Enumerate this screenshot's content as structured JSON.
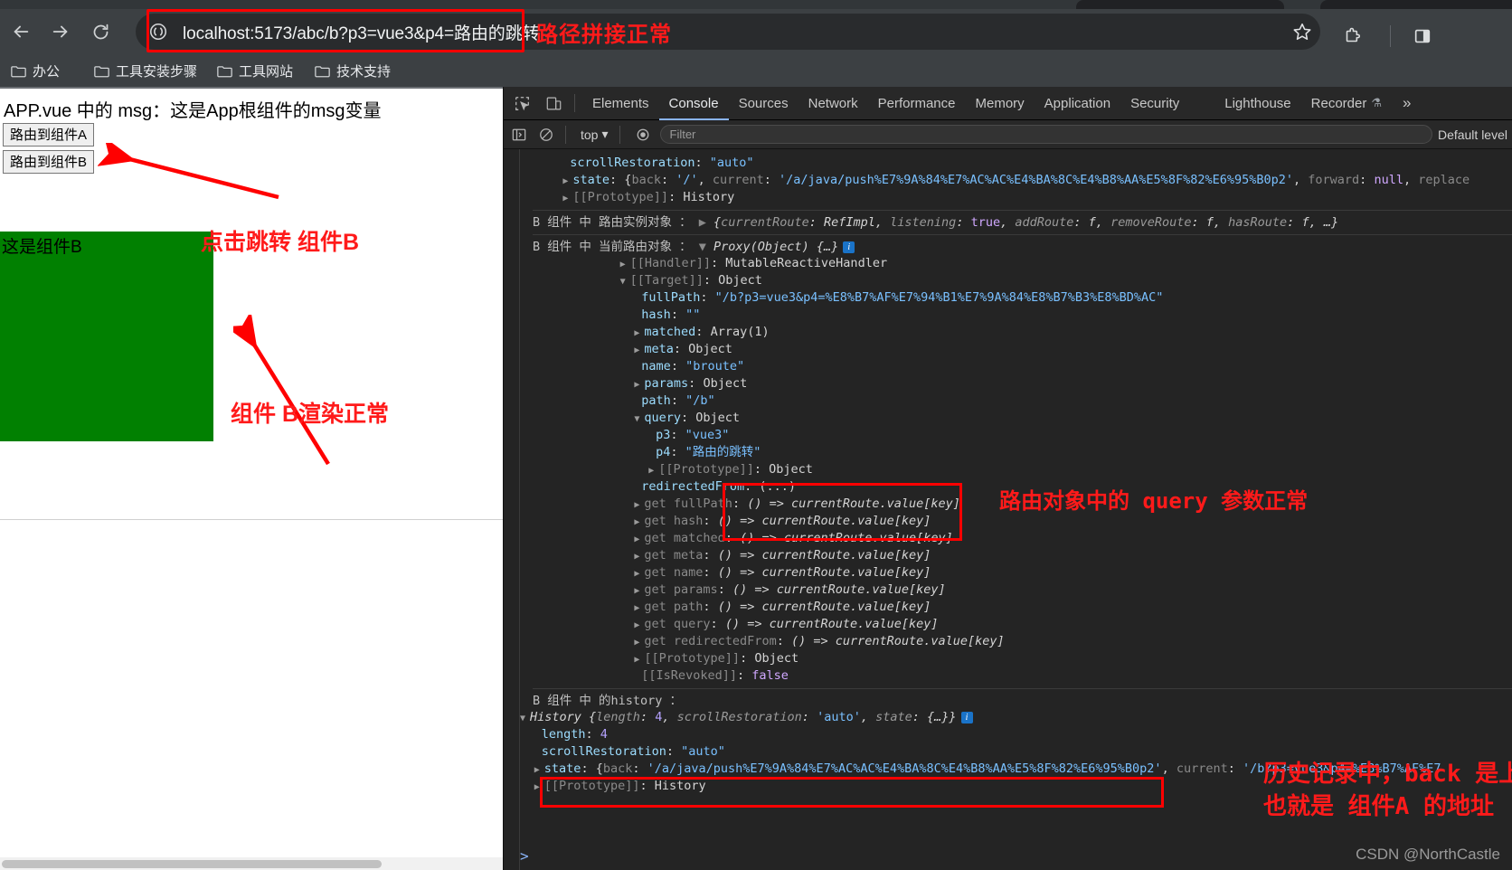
{
  "browser": {
    "url": "localhost:5173/abc/b?p3=vue3&p4=路由的跳转",
    "back_icon": "back-arrow-icon",
    "forward_icon": "forward-arrow-icon",
    "reload_icon": "reload-icon",
    "site_info_icon": "site-info-icon",
    "star_icon": "bookmark-star-icon",
    "extensions_icon": "extensions-puzzle-icon",
    "sidepanel_icon": "side-panel-icon",
    "bookmarks": [
      {
        "label": "办公"
      },
      {
        "label": "工具安装步骤"
      },
      {
        "label": "工具网站"
      },
      {
        "label": "技术支持"
      }
    ]
  },
  "annotations": {
    "url_note": "路径拼接正常",
    "jump_note": "点击跳转 组件B",
    "render_note": "组件 B渲染正常",
    "query_note": "路由对象中的 query 参数正常",
    "history_note_line1": "历史记录中，back 是上一个路由地址",
    "history_note_line2": "也就是 组件A 的地址",
    "color": "#ff1a1a"
  },
  "page": {
    "msg": "APP.vue 中的 msg：这是App根组件的msg变量",
    "button_a": "路由到组件A",
    "button_b": "路由到组件B",
    "component_b_label": "这是组件B",
    "component_b_color": "#018001"
  },
  "devtools": {
    "inspect_icon": "inspect-element-icon",
    "device_icon": "device-toolbar-icon",
    "tabs": [
      {
        "label": "Elements",
        "active": false
      },
      {
        "label": "Console",
        "active": true
      },
      {
        "label": "Sources",
        "active": false
      },
      {
        "label": "Network",
        "active": false
      },
      {
        "label": "Performance",
        "active": false
      },
      {
        "label": "Memory",
        "active": false
      },
      {
        "label": "Application",
        "active": false
      },
      {
        "label": "Security",
        "active": false
      },
      {
        "label": "Lighthouse",
        "active": false
      },
      {
        "label": "Recorder",
        "active": false,
        "flask": "⚗"
      }
    ],
    "more_tabs": "»",
    "filterbar": {
      "sidebar_icon": "console-sidebar-icon",
      "clear_icon": "clear-console-icon",
      "context": "top",
      "context_caret": "▾",
      "eye_icon": "live-expression-icon",
      "filter_placeholder": "Filter",
      "level": "Default level"
    },
    "prompt_caret": ">",
    "watermark": "CSDN @NorthCastle",
    "console_lines": [
      {
        "indent": 7,
        "parts": [
          {
            "t": "scrollRestoration",
            "c": "k-prop"
          },
          {
            "t": ": ",
            "c": "k-plain"
          },
          {
            "t": "\"auto\"",
            "c": "k-str"
          }
        ]
      },
      {
        "indent": 6,
        "tri": "▶",
        "parts": [
          {
            "t": "state",
            "c": "k-prop"
          },
          {
            "t": ": ",
            "c": "k-plain"
          },
          {
            "t": "{",
            "c": "k-plain"
          },
          {
            "t": "back",
            "c": "k-dim"
          },
          {
            "t": ": ",
            "c": "k-plain"
          },
          {
            "t": "'/'",
            "c": "k-str"
          },
          {
            "t": ", ",
            "c": "k-plain"
          },
          {
            "t": "current",
            "c": "k-dim"
          },
          {
            "t": ": ",
            "c": "k-plain"
          },
          {
            "t": "'/a/java/push%E7%9A%84%E7%AC%AC%E4%BA%8C%E4%B8%AA%E5%8F%82%E6%95%B0p2'",
            "c": "k-str"
          },
          {
            "t": ", ",
            "c": "k-plain"
          },
          {
            "t": "forward",
            "c": "k-dim"
          },
          {
            "t": ": ",
            "c": "k-plain"
          },
          {
            "t": "null",
            "c": "k-kw"
          },
          {
            "t": ", ",
            "c": "k-plain"
          },
          {
            "t": "replace",
            "c": "k-dim"
          }
        ]
      },
      {
        "indent": 6,
        "tri": "▶",
        "parts": [
          {
            "t": "[[Prototype]]",
            "c": "k-dim"
          },
          {
            "t": ": ",
            "c": "k-plain"
          },
          {
            "t": "History",
            "c": "k-plain"
          }
        ]
      },
      {
        "group": true,
        "indent": 0,
        "parts": [
          {
            "t": "B 组件 中 路由实例对象 ：",
            "c": "srcB"
          },
          {
            "t": "   ▶ ",
            "c": "k-dim"
          },
          {
            "t": "{",
            "c": "k-ital"
          },
          {
            "t": "currentRoute",
            "c": "k-ital-dim"
          },
          {
            "t": ": ",
            "c": "k-ital"
          },
          {
            "t": "RefImpl",
            "c": "k-ital"
          },
          {
            "t": ", ",
            "c": "k-ital"
          },
          {
            "t": "listening",
            "c": "k-ital-dim"
          },
          {
            "t": ": ",
            "c": "k-ital"
          },
          {
            "t": "true",
            "c": "k-kw"
          },
          {
            "t": ", ",
            "c": "k-ital"
          },
          {
            "t": "addRoute",
            "c": "k-ital-dim"
          },
          {
            "t": ": ",
            "c": "k-ital"
          },
          {
            "t": "f",
            "c": "k-ital"
          },
          {
            "t": ", ",
            "c": "k-ital"
          },
          {
            "t": "removeRoute",
            "c": "k-ital-dim"
          },
          {
            "t": ": ",
            "c": "k-ital"
          },
          {
            "t": "f",
            "c": "k-ital"
          },
          {
            "t": ", ",
            "c": "k-ital"
          },
          {
            "t": "hasRoute",
            "c": "k-ital-dim"
          },
          {
            "t": ": ",
            "c": "k-ital"
          },
          {
            "t": "f",
            "c": "k-ital"
          },
          {
            "t": ", …}",
            "c": "k-ital"
          }
        ]
      },
      {
        "group": true,
        "indent": 0,
        "parts": [
          {
            "t": "B 组件 中 当前路由对象 ：",
            "c": "srcB"
          },
          {
            "t": "   ▼ ",
            "c": "k-dim"
          },
          {
            "t": "Proxy(Object) {…}",
            "c": "k-ital"
          },
          {
            "t": " ⓘ",
            "c": "badge"
          }
        ]
      },
      {
        "indent": 14,
        "tri": "▶",
        "parts": [
          {
            "t": "[[Handler]]",
            "c": "k-dim"
          },
          {
            "t": ": ",
            "c": "k-plain"
          },
          {
            "t": "MutableReactiveHandler",
            "c": "k-plain"
          }
        ]
      },
      {
        "indent": 14,
        "tri": "▼",
        "parts": [
          {
            "t": "[[Target]]",
            "c": "k-dim"
          },
          {
            "t": ": ",
            "c": "k-plain"
          },
          {
            "t": "Object",
            "c": "k-plain"
          }
        ]
      },
      {
        "indent": 17,
        "parts": [
          {
            "t": "fullPath",
            "c": "k-prop"
          },
          {
            "t": ": ",
            "c": "k-plain"
          },
          {
            "t": "\"/b?p3=vue3&p4=%E8%B7%AF%E7%94%B1%E7%9A%84%E8%B7%B3%E8%BD%AC\"",
            "c": "k-str"
          }
        ]
      },
      {
        "indent": 17,
        "parts": [
          {
            "t": "hash",
            "c": "k-prop"
          },
          {
            "t": ": ",
            "c": "k-plain"
          },
          {
            "t": "\"\"",
            "c": "k-str"
          }
        ]
      },
      {
        "indent": 16,
        "tri": "▶",
        "parts": [
          {
            "t": "matched",
            "c": "k-prop"
          },
          {
            "t": ": ",
            "c": "k-plain"
          },
          {
            "t": "Array(1)",
            "c": "k-plain"
          }
        ]
      },
      {
        "indent": 16,
        "tri": "▶",
        "parts": [
          {
            "t": "meta",
            "c": "k-prop"
          },
          {
            "t": ": ",
            "c": "k-plain"
          },
          {
            "t": "Object",
            "c": "k-plain"
          }
        ]
      },
      {
        "indent": 17,
        "parts": [
          {
            "t": "name",
            "c": "k-prop"
          },
          {
            "t": ": ",
            "c": "k-plain"
          },
          {
            "t": "\"broute\"",
            "c": "k-str"
          }
        ]
      },
      {
        "indent": 16,
        "tri": "▶",
        "parts": [
          {
            "t": "params",
            "c": "k-prop"
          },
          {
            "t": ": ",
            "c": "k-plain"
          },
          {
            "t": "Object",
            "c": "k-plain"
          }
        ]
      },
      {
        "indent": 17,
        "parts": [
          {
            "t": "path",
            "c": "k-prop"
          },
          {
            "t": ": ",
            "c": "k-plain"
          },
          {
            "t": "\"/b\"",
            "c": "k-str"
          }
        ]
      },
      {
        "indent": 16,
        "tri": "▼",
        "parts": [
          {
            "t": "query",
            "c": "k-prop"
          },
          {
            "t": ": ",
            "c": "k-plain"
          },
          {
            "t": "Object",
            "c": "k-plain"
          }
        ]
      },
      {
        "indent": 19,
        "parts": [
          {
            "t": "p3",
            "c": "k-prop"
          },
          {
            "t": ": ",
            "c": "k-plain"
          },
          {
            "t": "\"vue3\"",
            "c": "k-str"
          }
        ]
      },
      {
        "indent": 19,
        "parts": [
          {
            "t": "p4",
            "c": "k-prop"
          },
          {
            "t": ": ",
            "c": "k-plain"
          },
          {
            "t": "\"路由的跳转\"",
            "c": "k-str"
          }
        ]
      },
      {
        "indent": 18,
        "tri": "▶",
        "parts": [
          {
            "t": "[[Prototype]]",
            "c": "k-dim"
          },
          {
            "t": ": ",
            "c": "k-plain"
          },
          {
            "t": "Object",
            "c": "k-plain"
          }
        ]
      },
      {
        "indent": 17,
        "parts": [
          {
            "t": "redirectedFrom",
            "c": "k-prop"
          },
          {
            "t": ": ",
            "c": "k-plain"
          },
          {
            "t": "(...)",
            "c": "k-plain"
          }
        ]
      },
      {
        "indent": 16,
        "tri": "▶",
        "parts": [
          {
            "t": "get ",
            "c": "k-getter"
          },
          {
            "t": "fullPath",
            "c": "k-getter"
          },
          {
            "t": ": ",
            "c": "k-plain"
          },
          {
            "t": "() => currentRoute.value[key]",
            "c": "k-fn"
          }
        ]
      },
      {
        "indent": 16,
        "tri": "▶",
        "parts": [
          {
            "t": "get ",
            "c": "k-getter"
          },
          {
            "t": "hash",
            "c": "k-getter"
          },
          {
            "t": ": ",
            "c": "k-plain"
          },
          {
            "t": "() => currentRoute.value[key]",
            "c": "k-fn"
          }
        ]
      },
      {
        "indent": 16,
        "tri": "▶",
        "parts": [
          {
            "t": "get ",
            "c": "k-getter"
          },
          {
            "t": "matched",
            "c": "k-getter"
          },
          {
            "t": ": ",
            "c": "k-plain"
          },
          {
            "t": "() => currentRoute.value[key]",
            "c": "k-fn"
          }
        ]
      },
      {
        "indent": 16,
        "tri": "▶",
        "parts": [
          {
            "t": "get ",
            "c": "k-getter"
          },
          {
            "t": "meta",
            "c": "k-getter"
          },
          {
            "t": ": ",
            "c": "k-plain"
          },
          {
            "t": "() => currentRoute.value[key]",
            "c": "k-fn"
          }
        ]
      },
      {
        "indent": 16,
        "tri": "▶",
        "parts": [
          {
            "t": "get ",
            "c": "k-getter"
          },
          {
            "t": "name",
            "c": "k-getter"
          },
          {
            "t": ": ",
            "c": "k-plain"
          },
          {
            "t": "() => currentRoute.value[key]",
            "c": "k-fn"
          }
        ]
      },
      {
        "indent": 16,
        "tri": "▶",
        "parts": [
          {
            "t": "get ",
            "c": "k-getter"
          },
          {
            "t": "params",
            "c": "k-getter"
          },
          {
            "t": ": ",
            "c": "k-plain"
          },
          {
            "t": "() => currentRoute.value[key]",
            "c": "k-fn"
          }
        ]
      },
      {
        "indent": 16,
        "tri": "▶",
        "parts": [
          {
            "t": "get ",
            "c": "k-getter"
          },
          {
            "t": "path",
            "c": "k-getter"
          },
          {
            "t": ": ",
            "c": "k-plain"
          },
          {
            "t": "() => currentRoute.value[key]",
            "c": "k-fn"
          }
        ]
      },
      {
        "indent": 16,
        "tri": "▶",
        "parts": [
          {
            "t": "get ",
            "c": "k-getter"
          },
          {
            "t": "query",
            "c": "k-getter"
          },
          {
            "t": ": ",
            "c": "k-plain"
          },
          {
            "t": "() => currentRoute.value[key]",
            "c": "k-fn"
          }
        ]
      },
      {
        "indent": 16,
        "tri": "▶",
        "parts": [
          {
            "t": "get ",
            "c": "k-getter"
          },
          {
            "t": "redirectedFrom",
            "c": "k-getter"
          },
          {
            "t": ": ",
            "c": "k-plain"
          },
          {
            "t": "() => currentRoute.value[key]",
            "c": "k-fn"
          }
        ]
      },
      {
        "indent": 16,
        "tri": "▶",
        "parts": [
          {
            "t": "[[Prototype]]",
            "c": "k-dim"
          },
          {
            "t": ": ",
            "c": "k-plain"
          },
          {
            "t": "Object",
            "c": "k-plain"
          }
        ]
      },
      {
        "indent": 17,
        "parts": [
          {
            "t": "[[IsRevoked]]",
            "c": "k-dim"
          },
          {
            "t": ": ",
            "c": "k-plain"
          },
          {
            "t": "false",
            "c": "k-kw"
          }
        ]
      },
      {
        "group": true,
        "indent": 0,
        "parts": [
          {
            "t": "B 组件 中 的history ：",
            "c": "srcB"
          }
        ]
      },
      {
        "indent": 0,
        "tri": "▼",
        "parts": [
          {
            "t": "History ",
            "c": "k-ital"
          },
          {
            "t": "{",
            "c": "k-ital"
          },
          {
            "t": "length",
            "c": "k-ital-dim"
          },
          {
            "t": ": ",
            "c": "k-ital"
          },
          {
            "t": "4",
            "c": "k-num"
          },
          {
            "t": ", ",
            "c": "k-ital"
          },
          {
            "t": "scrollRestoration",
            "c": "k-ital-dim"
          },
          {
            "t": ": ",
            "c": "k-ital"
          },
          {
            "t": "'auto'",
            "c": "k-str"
          },
          {
            "t": ", ",
            "c": "k-ital"
          },
          {
            "t": "state",
            "c": "k-ital-dim"
          },
          {
            "t": ": ",
            "c": "k-ital"
          },
          {
            "t": "{…}}",
            "c": "k-ital"
          },
          {
            "t": " ⓘ",
            "c": "badge"
          }
        ]
      },
      {
        "indent": 3,
        "parts": [
          {
            "t": "length",
            "c": "k-prop"
          },
          {
            "t": ": ",
            "c": "k-plain"
          },
          {
            "t": "4",
            "c": "k-num"
          }
        ]
      },
      {
        "indent": 3,
        "parts": [
          {
            "t": "scrollRestoration",
            "c": "k-prop"
          },
          {
            "t": ": ",
            "c": "k-plain"
          },
          {
            "t": "\"auto\"",
            "c": "k-str"
          }
        ]
      },
      {
        "indent": 2,
        "tri": "▶",
        "parts": [
          {
            "t": "state",
            "c": "k-prop"
          },
          {
            "t": ": ",
            "c": "k-plain"
          },
          {
            "t": "{",
            "c": "k-plain"
          },
          {
            "t": "back",
            "c": "k-dim"
          },
          {
            "t": ": ",
            "c": "k-plain"
          },
          {
            "t": "'/a/java/push%E7%9A%84%E7%AC%AC%E4%BA%8C%E4%B8%AA%E5%8F%82%E6%95%B0p2'",
            "c": "k-str"
          },
          {
            "t": ", ",
            "c": "k-plain"
          },
          {
            "t": "current",
            "c": "k-dim"
          },
          {
            "t": ": ",
            "c": "k-plain"
          },
          {
            "t": "'/b?p3=vue3&p4=%E8%B7%AF%E7",
            "c": "k-str"
          }
        ]
      },
      {
        "indent": 2,
        "tri": "▶",
        "parts": [
          {
            "t": "[[Prototype]]",
            "c": "k-dim"
          },
          {
            "t": ": ",
            "c": "k-plain"
          },
          {
            "t": "History",
            "c": "k-plain"
          }
        ]
      }
    ]
  }
}
